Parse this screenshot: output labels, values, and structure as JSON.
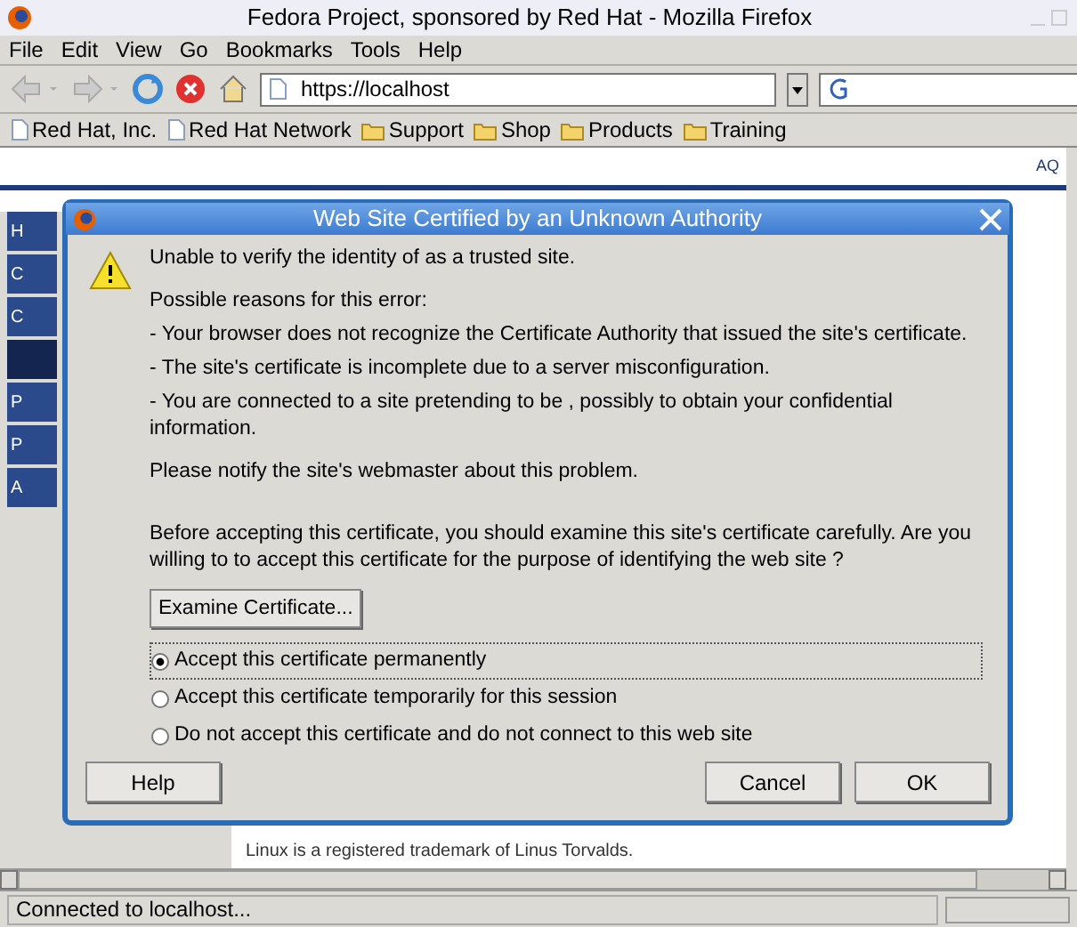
{
  "window": {
    "title": "Fedora Project, sponsored by Red Hat - Mozilla Firefox"
  },
  "menu": [
    {
      "label": "File"
    },
    {
      "label": "Edit"
    },
    {
      "label": "View"
    },
    {
      "label": "Go"
    },
    {
      "label": "Bookmarks"
    },
    {
      "label": "Tools"
    },
    {
      "label": "Help"
    }
  ],
  "address_bar": {
    "value": "https://localhost"
  },
  "bookmarks": [
    {
      "label": "Red Hat, Inc.",
      "kind": "page"
    },
    {
      "label": "Red Hat Network",
      "kind": "page"
    },
    {
      "label": "Support",
      "kind": "folder"
    },
    {
      "label": "Shop",
      "kind": "folder"
    },
    {
      "label": "Products",
      "kind": "folder"
    },
    {
      "label": "Training",
      "kind": "folder"
    }
  ],
  "page": {
    "nav_items": [
      {
        "label": "H",
        "selected": false
      },
      {
        "label": "C",
        "selected": false
      },
      {
        "label": "C",
        "selected": false
      },
      {
        "selected": true
      },
      {
        "label": "P",
        "selected": false
      },
      {
        "label": "P",
        "selected": false
      },
      {
        "label": "A",
        "selected": false
      }
    ],
    "corner_text": "AQ",
    "footer_text": "Linux is a registered trademark of Linus Torvalds."
  },
  "dialog": {
    "title": "Web Site Certified by an Unknown Authority",
    "headline": "Unable to verify the identity of as a trusted site.",
    "paragraphs": [
      "Possible reasons for this error:",
      "- Your browser does not recognize the Certificate Authority that issued the site's certificate.",
      "- The site's certificate is incomplete due to a server misconfiguration.",
      "- You are connected to a site pretending to be , possibly to obtain your confidential information.",
      "Please notify the site's webmaster about this problem."
    ],
    "question": "Before accepting this certificate, you should examine this site's certificate carefully. Are you willing to to accept this certificate for the purpose of identifying the web site ?",
    "examine_button": "Examine Certificate...",
    "options": [
      {
        "label": "Accept this certificate permanently",
        "selected": true
      },
      {
        "label": "Accept this certificate temporarily for this session",
        "selected": false
      },
      {
        "label": "Do not accept this certificate and do not connect to this web site",
        "selected": false
      }
    ],
    "help_button": {
      "label": "Help"
    },
    "buttons": [
      "Cancel",
      "OK"
    ]
  },
  "status_bar": {
    "text": "Connected to localhost..."
  }
}
